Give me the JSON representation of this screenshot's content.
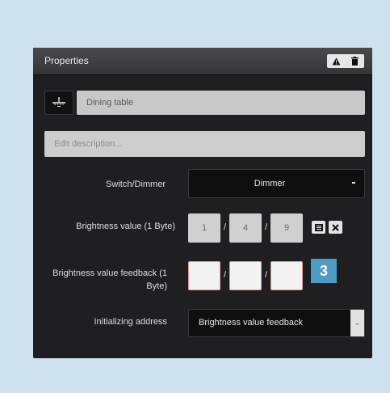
{
  "panel": {
    "title": "Properties",
    "header_icons": [
      "warning-icon",
      "trash-icon"
    ]
  },
  "object": {
    "icon": "light-fixture-icon",
    "name": "Dining table"
  },
  "description": {
    "placeholder": "Edit description...",
    "value": ""
  },
  "switch_dimmer": {
    "label": "Switch/Dimmer",
    "value": "Dimmer"
  },
  "brightness_value": {
    "label": "Brightness value (1 Byte)",
    "address": [
      "1",
      "4",
      "9"
    ],
    "separator": "/",
    "icons": [
      "select-address-icon",
      "clear-icon"
    ]
  },
  "brightness_feedback": {
    "label": "Brightness value feedback (1 Byte)",
    "address": [
      "",
      "",
      ""
    ],
    "separator": "/"
  },
  "initializing_address": {
    "label": "Initializing address",
    "value": "Brightness value feedback"
  },
  "callout": {
    "number": "3",
    "color": "#4d9cc6"
  }
}
